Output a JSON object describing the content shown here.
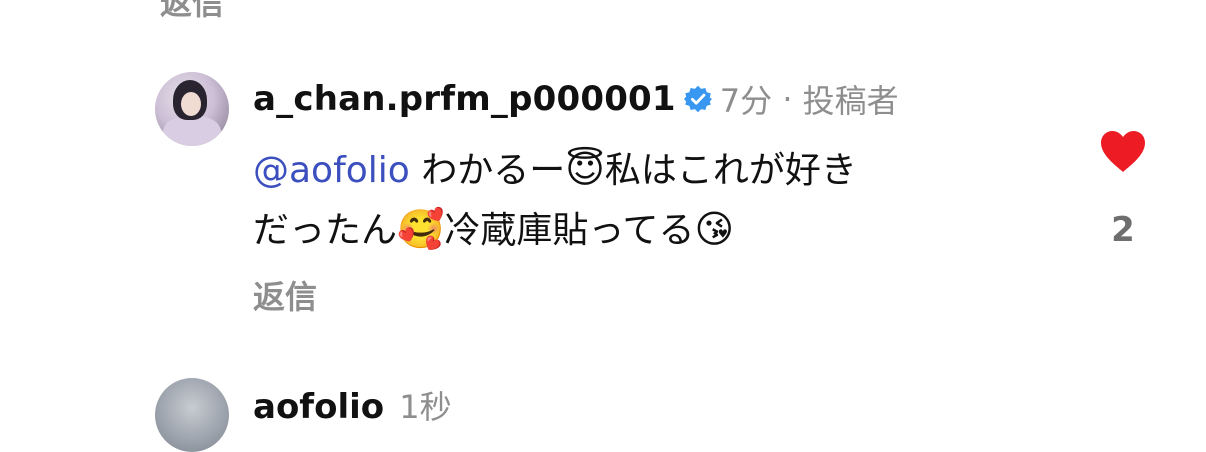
{
  "previous_comment": {
    "reply_label": "返信"
  },
  "comment": {
    "username": "a_chan.prfm_p000001",
    "verified": true,
    "time": "7分",
    "separator": "·",
    "role": "投稿者",
    "mention": "@aofolio",
    "text_1": " わかるー",
    "emoji_1": "😇",
    "text_2": "私はこれが好き",
    "text_3": "だったん",
    "emoji_2": "🥰",
    "text_4": "冷蔵庫貼ってる",
    "emoji_3": "😘",
    "reply_label": "返信",
    "like_count": "2",
    "liked": true,
    "heart_color": "#ed1c24",
    "verified_color": "#3897f0",
    "mention_color": "#3b4fbf"
  },
  "next_comment": {
    "username": "aofolio",
    "time": "1秒"
  }
}
